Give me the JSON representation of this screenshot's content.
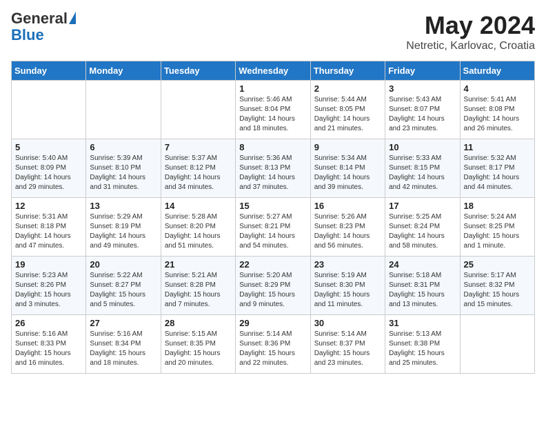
{
  "logo": {
    "general": "General",
    "blue": "Blue"
  },
  "title": {
    "month": "May 2024",
    "location": "Netretic, Karlovac, Croatia"
  },
  "days_of_week": [
    "Sunday",
    "Monday",
    "Tuesday",
    "Wednesday",
    "Thursday",
    "Friday",
    "Saturday"
  ],
  "weeks": [
    [
      {
        "day": "",
        "info": ""
      },
      {
        "day": "",
        "info": ""
      },
      {
        "day": "",
        "info": ""
      },
      {
        "day": "1",
        "info": "Sunrise: 5:46 AM\nSunset: 8:04 PM\nDaylight: 14 hours\nand 18 minutes."
      },
      {
        "day": "2",
        "info": "Sunrise: 5:44 AM\nSunset: 8:05 PM\nDaylight: 14 hours\nand 21 minutes."
      },
      {
        "day": "3",
        "info": "Sunrise: 5:43 AM\nSunset: 8:07 PM\nDaylight: 14 hours\nand 23 minutes."
      },
      {
        "day": "4",
        "info": "Sunrise: 5:41 AM\nSunset: 8:08 PM\nDaylight: 14 hours\nand 26 minutes."
      }
    ],
    [
      {
        "day": "5",
        "info": "Sunrise: 5:40 AM\nSunset: 8:09 PM\nDaylight: 14 hours\nand 29 minutes."
      },
      {
        "day": "6",
        "info": "Sunrise: 5:39 AM\nSunset: 8:10 PM\nDaylight: 14 hours\nand 31 minutes."
      },
      {
        "day": "7",
        "info": "Sunrise: 5:37 AM\nSunset: 8:12 PM\nDaylight: 14 hours\nand 34 minutes."
      },
      {
        "day": "8",
        "info": "Sunrise: 5:36 AM\nSunset: 8:13 PM\nDaylight: 14 hours\nand 37 minutes."
      },
      {
        "day": "9",
        "info": "Sunrise: 5:34 AM\nSunset: 8:14 PM\nDaylight: 14 hours\nand 39 minutes."
      },
      {
        "day": "10",
        "info": "Sunrise: 5:33 AM\nSunset: 8:15 PM\nDaylight: 14 hours\nand 42 minutes."
      },
      {
        "day": "11",
        "info": "Sunrise: 5:32 AM\nSunset: 8:17 PM\nDaylight: 14 hours\nand 44 minutes."
      }
    ],
    [
      {
        "day": "12",
        "info": "Sunrise: 5:31 AM\nSunset: 8:18 PM\nDaylight: 14 hours\nand 47 minutes."
      },
      {
        "day": "13",
        "info": "Sunrise: 5:29 AM\nSunset: 8:19 PM\nDaylight: 14 hours\nand 49 minutes."
      },
      {
        "day": "14",
        "info": "Sunrise: 5:28 AM\nSunset: 8:20 PM\nDaylight: 14 hours\nand 51 minutes."
      },
      {
        "day": "15",
        "info": "Sunrise: 5:27 AM\nSunset: 8:21 PM\nDaylight: 14 hours\nand 54 minutes."
      },
      {
        "day": "16",
        "info": "Sunrise: 5:26 AM\nSunset: 8:23 PM\nDaylight: 14 hours\nand 56 minutes."
      },
      {
        "day": "17",
        "info": "Sunrise: 5:25 AM\nSunset: 8:24 PM\nDaylight: 14 hours\nand 58 minutes."
      },
      {
        "day": "18",
        "info": "Sunrise: 5:24 AM\nSunset: 8:25 PM\nDaylight: 15 hours\nand 1 minute."
      }
    ],
    [
      {
        "day": "19",
        "info": "Sunrise: 5:23 AM\nSunset: 8:26 PM\nDaylight: 15 hours\nand 3 minutes."
      },
      {
        "day": "20",
        "info": "Sunrise: 5:22 AM\nSunset: 8:27 PM\nDaylight: 15 hours\nand 5 minutes."
      },
      {
        "day": "21",
        "info": "Sunrise: 5:21 AM\nSunset: 8:28 PM\nDaylight: 15 hours\nand 7 minutes."
      },
      {
        "day": "22",
        "info": "Sunrise: 5:20 AM\nSunset: 8:29 PM\nDaylight: 15 hours\nand 9 minutes."
      },
      {
        "day": "23",
        "info": "Sunrise: 5:19 AM\nSunset: 8:30 PM\nDaylight: 15 hours\nand 11 minutes."
      },
      {
        "day": "24",
        "info": "Sunrise: 5:18 AM\nSunset: 8:31 PM\nDaylight: 15 hours\nand 13 minutes."
      },
      {
        "day": "25",
        "info": "Sunrise: 5:17 AM\nSunset: 8:32 PM\nDaylight: 15 hours\nand 15 minutes."
      }
    ],
    [
      {
        "day": "26",
        "info": "Sunrise: 5:16 AM\nSunset: 8:33 PM\nDaylight: 15 hours\nand 16 minutes."
      },
      {
        "day": "27",
        "info": "Sunrise: 5:16 AM\nSunset: 8:34 PM\nDaylight: 15 hours\nand 18 minutes."
      },
      {
        "day": "28",
        "info": "Sunrise: 5:15 AM\nSunset: 8:35 PM\nDaylight: 15 hours\nand 20 minutes."
      },
      {
        "day": "29",
        "info": "Sunrise: 5:14 AM\nSunset: 8:36 PM\nDaylight: 15 hours\nand 22 minutes."
      },
      {
        "day": "30",
        "info": "Sunrise: 5:14 AM\nSunset: 8:37 PM\nDaylight: 15 hours\nand 23 minutes."
      },
      {
        "day": "31",
        "info": "Sunrise: 5:13 AM\nSunset: 8:38 PM\nDaylight: 15 hours\nand 25 minutes."
      },
      {
        "day": "",
        "info": ""
      }
    ]
  ]
}
